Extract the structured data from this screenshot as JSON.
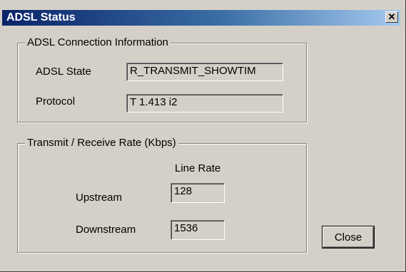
{
  "window": {
    "title": "ADSL Status",
    "close_glyph": "✕"
  },
  "connection": {
    "legend": "ADSL Connection Information",
    "state_label": "ADSL State",
    "state_value": "R_TRANSMIT_SHOWTIM",
    "protocol_label": "Protocol",
    "protocol_value": "T 1.413 i2"
  },
  "rates": {
    "legend": "Transmit / Receive Rate  (Kbps)",
    "column_header": "Line Rate",
    "upstream_label": "Upstream",
    "upstream_value": "128",
    "downstream_label": "Downstream",
    "downstream_value": "1536"
  },
  "buttons": {
    "close_label": "Close"
  },
  "colors": {
    "face": "#d4d0c8",
    "title_start": "#0a246a",
    "title_end": "#a6caf0"
  }
}
